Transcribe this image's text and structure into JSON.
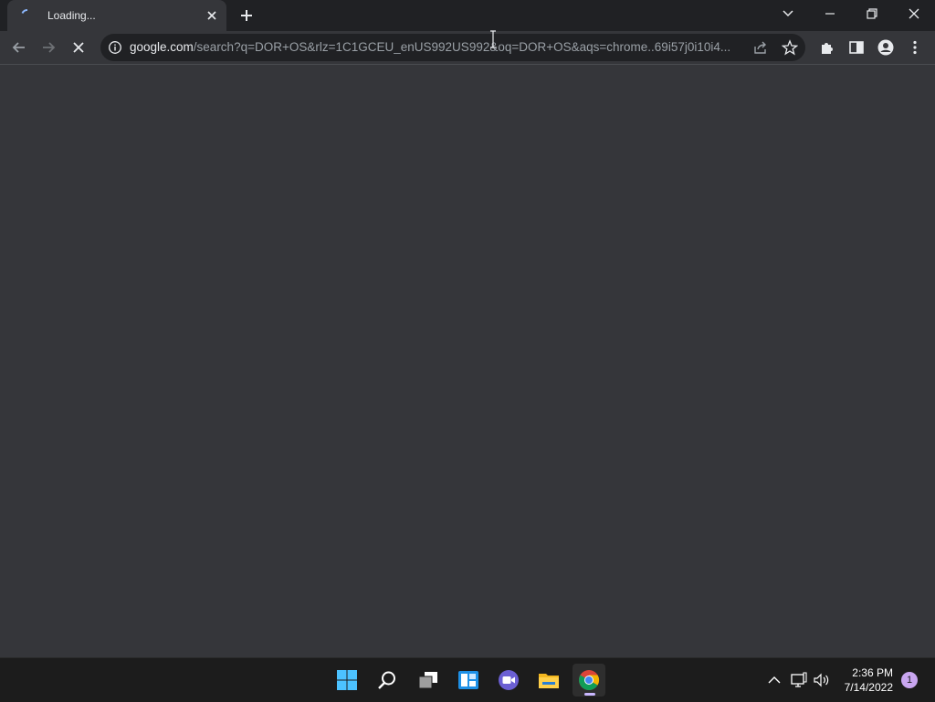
{
  "browser": {
    "tab": {
      "title": "Loading..."
    },
    "address": {
      "host": "google.com",
      "path": "/search?q=DOR+OS&rlz=1C1GCEU_enUS992US992&oq=DOR+OS&aqs=chrome..69i57j0i10i4..."
    }
  },
  "taskbar": {
    "apps": [
      "start",
      "search",
      "task-view",
      "widgets",
      "teams-chat",
      "file-explorer",
      "chrome"
    ],
    "active_app": "chrome",
    "clock": {
      "time": "2:36 PM",
      "date": "7/14/2022"
    },
    "notification_count": "1"
  },
  "colors": {
    "tabstrip": "#202124",
    "toolbar": "#35363a",
    "omnibox": "#202124",
    "taskbar": "#1c1c1c",
    "accent": "#c9b7ff"
  }
}
